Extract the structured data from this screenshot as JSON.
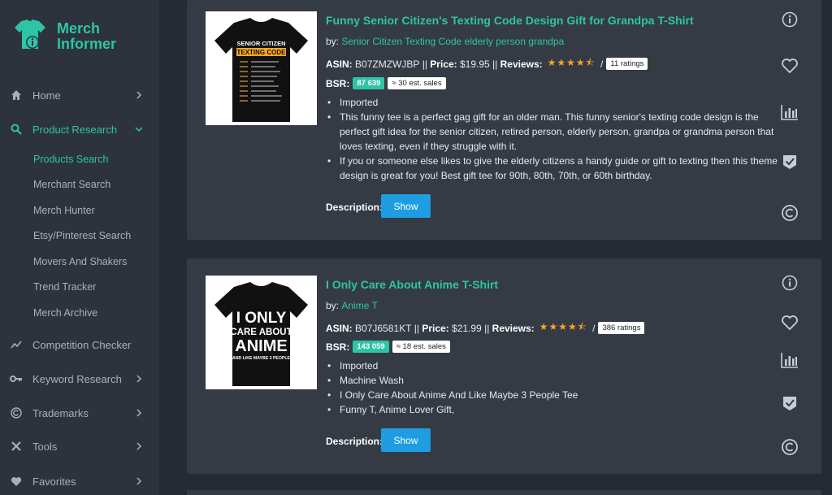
{
  "brand": {
    "name_line1": "Merch",
    "name_line2": "Informer",
    "accent": "#2ec4a6"
  },
  "sidebar": {
    "items": [
      {
        "label": "Home",
        "icon": "home-icon"
      },
      {
        "label": "Product Research",
        "icon": "search-icon"
      },
      {
        "label": "Competition Checker",
        "icon": "trend-icon"
      },
      {
        "label": "Keyword Research",
        "icon": "key-icon"
      },
      {
        "label": "Trademarks",
        "icon": "copyright-icon"
      },
      {
        "label": "Tools",
        "icon": "tools-icon"
      },
      {
        "label": "Favorites",
        "icon": "heart-icon"
      }
    ],
    "subitems": [
      {
        "label": "Products Search"
      },
      {
        "label": "Merchant Search"
      },
      {
        "label": "Merch Hunter"
      },
      {
        "label": "Etsy/Pinterest Search"
      },
      {
        "label": "Movers And Shakers"
      },
      {
        "label": "Trend Tracker"
      },
      {
        "label": "Merch Archive"
      }
    ]
  },
  "products": [
    {
      "title": "Funny Senior Citizen's Texting Code Design Gift for Grandpa T-Shirt",
      "by_label": "by:",
      "brand": "Senior Citizen Texting Code elderly person grandpa",
      "asin_label": "ASIN:",
      "asin": "B07ZMZWJBP",
      "price_label": "Price:",
      "price": "$19.95",
      "reviews_label": "Reviews:",
      "rating": 4.5,
      "ratings_count": "11 ratings",
      "bsr_label": "BSR:",
      "bsr": "87 639",
      "est_sales": "≈ 30 est. sales",
      "bullets": [
        "Imported",
        "This funny tee is a perfect gag gift for an older man. This funny senior's texting code design is the perfect gift idea for the senior citizen, retired person, elderly person, grandpa or grandma person that loves texting, even if they struggle with it.",
        "If you or someone else likes to give the elderly citizens a handy guide or gift to texting then this theme design is great for you! Best gift tee for 90th, 80th, 70th, or 60th birthday."
      ],
      "description_label": "Description:",
      "show_label": "Show",
      "shirt_text": [
        "SENIOR CITIZEN",
        "TEXTING CODE"
      ]
    },
    {
      "title": "I Only Care About Anime T-Shirt",
      "by_label": "by:",
      "brand": "Anime T",
      "asin_label": "ASIN:",
      "asin": "B07J6581KT",
      "price_label": "Price:",
      "price": "$21.99",
      "reviews_label": "Reviews:",
      "rating": 4.5,
      "ratings_count": "386 ratings",
      "bsr_label": "BSR:",
      "bsr": "143 059",
      "est_sales": "≈ 18 est. sales",
      "bullets": [
        "Imported",
        "Machine Wash",
        "I Only Care About Anime And Like Maybe 3 People Tee",
        "Funny T, Anime Lover Gift,"
      ],
      "description_label": "Description:",
      "show_label": "Show",
      "shirt_text": [
        "I ONLY",
        "CARE ABOUT",
        "ANIME",
        "AND LIKE MAYBE 3 PEOPLE"
      ]
    }
  ],
  "separators": {
    "pipe": "||",
    "slash": "/"
  }
}
